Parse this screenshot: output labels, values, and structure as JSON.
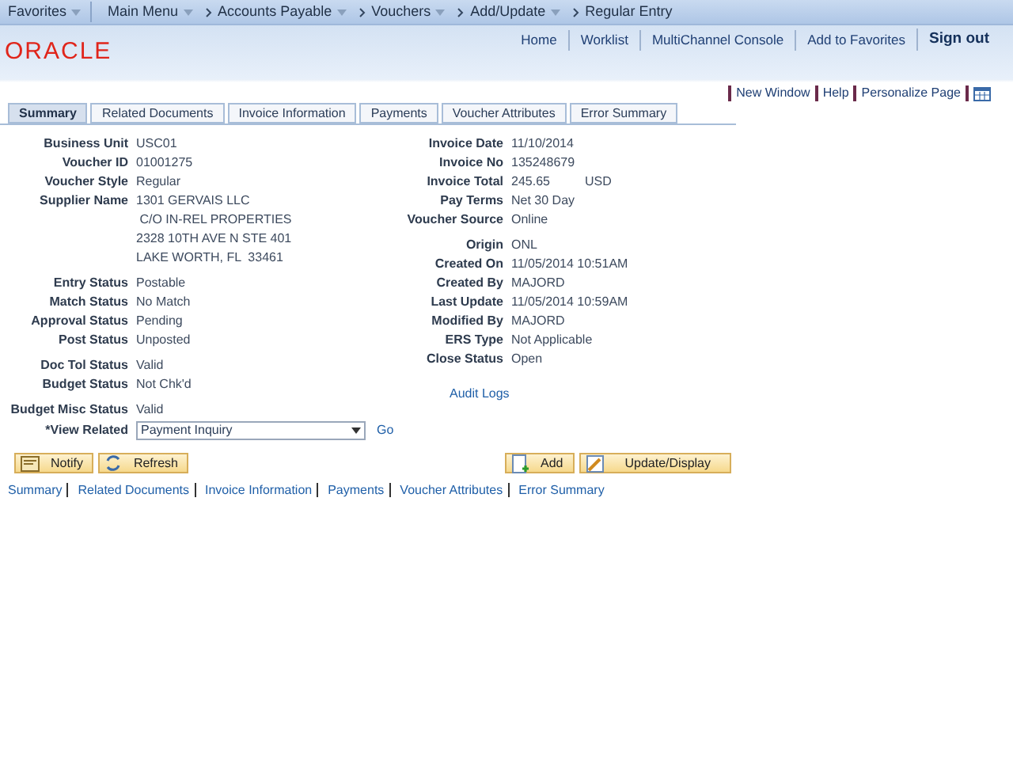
{
  "nav": [
    {
      "label": "Favorites",
      "dropdown": true
    },
    {
      "label": "Main Menu",
      "dropdown": true
    },
    {
      "label": "Accounts Payable",
      "dropdown": true
    },
    {
      "label": "Vouchers",
      "dropdown": true
    },
    {
      "label": "Add/Update",
      "dropdown": true
    },
    {
      "label": "Regular Entry",
      "dropdown": false
    }
  ],
  "header_links": [
    "Home",
    "Worklist",
    "MultiChannel Console",
    "Add to Favorites",
    "Sign out"
  ],
  "logo": "ORACLE",
  "page_links": [
    "New Window",
    "Help",
    "Personalize Page"
  ],
  "tabs": [
    {
      "label": "Summary",
      "selected": true
    },
    {
      "label": "Related Documents",
      "selected": false
    },
    {
      "label": "Invoice Information",
      "selected": false
    },
    {
      "label": "Payments",
      "selected": false
    },
    {
      "label": "Voucher Attributes",
      "selected": false
    },
    {
      "label": "Error Summary",
      "selected": false
    }
  ],
  "left_groups": [
    [
      {
        "label": "Business Unit",
        "lines": [
          "USC01"
        ]
      },
      {
        "label": "Voucher ID",
        "lines": [
          "01001275"
        ]
      },
      {
        "label": "Voucher Style",
        "lines": [
          "Regular"
        ]
      },
      {
        "label": "Supplier Name",
        "lines": [
          "1301 GERVAIS LLC",
          " C/O IN-REL PROPERTIES",
          "2328 10TH AVE N STE 401",
          "LAKE WORTH, FL  33461"
        ]
      }
    ],
    [
      {
        "label": "Entry Status",
        "lines": [
          "Postable"
        ]
      },
      {
        "label": "Match Status",
        "lines": [
          "No Match"
        ]
      },
      {
        "label": "Approval Status",
        "lines": [
          "Pending"
        ]
      },
      {
        "label": "Post Status",
        "lines": [
          "Unposted"
        ]
      }
    ],
    [
      {
        "label": "Doc Tol Status",
        "lines": [
          "Valid"
        ]
      },
      {
        "label": "Budget Status",
        "lines": [
          "Not Chk'd"
        ]
      }
    ],
    [
      {
        "label": "Budget Misc Status",
        "lines": [
          "Valid"
        ]
      }
    ]
  ],
  "view_related": {
    "label": "*View Related",
    "value": "Payment Inquiry",
    "go": "Go"
  },
  "right_groups": [
    [
      {
        "label": "Invoice Date",
        "lines": [
          "11/10/2014"
        ]
      },
      {
        "label": "Invoice No",
        "lines": [
          "135248679"
        ]
      },
      {
        "label": "Invoice Total",
        "lines": [
          "245.65"
        ],
        "currency": "USD"
      },
      {
        "label": "Pay Terms",
        "lines": [
          "Net 30 Day"
        ]
      },
      {
        "label": "Voucher Source",
        "lines": [
          "Online"
        ]
      }
    ],
    [
      {
        "label": "Origin",
        "lines": [
          "ONL"
        ]
      },
      {
        "label": "Created On",
        "lines": [
          "11/05/2014 10:51AM"
        ]
      },
      {
        "label": "Created By",
        "lines": [
          "MAJORD"
        ]
      },
      {
        "label": "Last Update",
        "lines": [
          "11/05/2014 10:59AM"
        ]
      },
      {
        "label": "Modified By",
        "lines": [
          "MAJORD"
        ]
      },
      {
        "label": "ERS Type",
        "lines": [
          "Not Applicable"
        ]
      },
      {
        "label": "Close Status",
        "lines": [
          "Open"
        ]
      }
    ]
  ],
  "audit_logs": "Audit Logs",
  "buttons_left": [
    {
      "label": "Notify",
      "kind": "notify"
    },
    {
      "label": "Refresh",
      "kind": "refresh"
    }
  ],
  "buttons_right": [
    {
      "label": "Add",
      "kind": "add"
    },
    {
      "label": "Update/Display",
      "kind": "update"
    }
  ],
  "bottom_links": [
    "Summary",
    "Related Documents",
    "Invoice Information",
    "Payments",
    "Voucher Attributes",
    "Error Summary"
  ]
}
